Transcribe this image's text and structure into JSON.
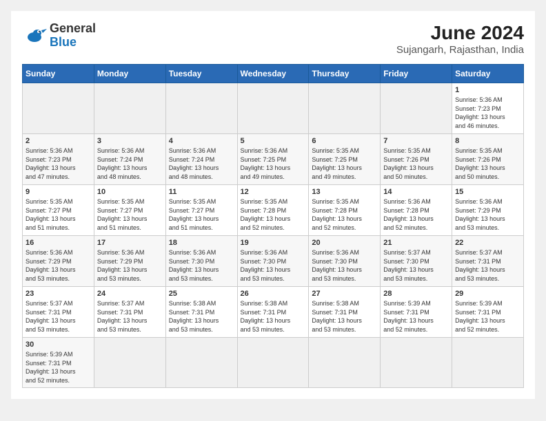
{
  "header": {
    "logo_general": "General",
    "logo_blue": "Blue",
    "title": "June 2024",
    "subtitle": "Sujangarh, Rajasthan, India"
  },
  "days_of_week": [
    "Sunday",
    "Monday",
    "Tuesday",
    "Wednesday",
    "Thursday",
    "Friday",
    "Saturday"
  ],
  "weeks": [
    [
      {
        "day": "",
        "info": ""
      },
      {
        "day": "",
        "info": ""
      },
      {
        "day": "",
        "info": ""
      },
      {
        "day": "",
        "info": ""
      },
      {
        "day": "",
        "info": ""
      },
      {
        "day": "",
        "info": ""
      },
      {
        "day": "1",
        "info": "Sunrise: 5:36 AM\nSunset: 7:23 PM\nDaylight: 13 hours\nand 46 minutes."
      }
    ],
    [
      {
        "day": "2",
        "info": "Sunrise: 5:36 AM\nSunset: 7:23 PM\nDaylight: 13 hours\nand 47 minutes."
      },
      {
        "day": "3",
        "info": "Sunrise: 5:36 AM\nSunset: 7:24 PM\nDaylight: 13 hours\nand 48 minutes."
      },
      {
        "day": "4",
        "info": "Sunrise: 5:36 AM\nSunset: 7:24 PM\nDaylight: 13 hours\nand 48 minutes."
      },
      {
        "day": "5",
        "info": "Sunrise: 5:36 AM\nSunset: 7:25 PM\nDaylight: 13 hours\nand 49 minutes."
      },
      {
        "day": "6",
        "info": "Sunrise: 5:35 AM\nSunset: 7:25 PM\nDaylight: 13 hours\nand 49 minutes."
      },
      {
        "day": "7",
        "info": "Sunrise: 5:35 AM\nSunset: 7:26 PM\nDaylight: 13 hours\nand 50 minutes."
      },
      {
        "day": "8",
        "info": "Sunrise: 5:35 AM\nSunset: 7:26 PM\nDaylight: 13 hours\nand 50 minutes."
      }
    ],
    [
      {
        "day": "9",
        "info": "Sunrise: 5:35 AM\nSunset: 7:27 PM\nDaylight: 13 hours\nand 51 minutes."
      },
      {
        "day": "10",
        "info": "Sunrise: 5:35 AM\nSunset: 7:27 PM\nDaylight: 13 hours\nand 51 minutes."
      },
      {
        "day": "11",
        "info": "Sunrise: 5:35 AM\nSunset: 7:27 PM\nDaylight: 13 hours\nand 51 minutes."
      },
      {
        "day": "12",
        "info": "Sunrise: 5:35 AM\nSunset: 7:28 PM\nDaylight: 13 hours\nand 52 minutes."
      },
      {
        "day": "13",
        "info": "Sunrise: 5:35 AM\nSunset: 7:28 PM\nDaylight: 13 hours\nand 52 minutes."
      },
      {
        "day": "14",
        "info": "Sunrise: 5:36 AM\nSunset: 7:28 PM\nDaylight: 13 hours\nand 52 minutes."
      },
      {
        "day": "15",
        "info": "Sunrise: 5:36 AM\nSunset: 7:29 PM\nDaylight: 13 hours\nand 53 minutes."
      }
    ],
    [
      {
        "day": "16",
        "info": "Sunrise: 5:36 AM\nSunset: 7:29 PM\nDaylight: 13 hours\nand 53 minutes."
      },
      {
        "day": "17",
        "info": "Sunrise: 5:36 AM\nSunset: 7:29 PM\nDaylight: 13 hours\nand 53 minutes."
      },
      {
        "day": "18",
        "info": "Sunrise: 5:36 AM\nSunset: 7:30 PM\nDaylight: 13 hours\nand 53 minutes."
      },
      {
        "day": "19",
        "info": "Sunrise: 5:36 AM\nSunset: 7:30 PM\nDaylight: 13 hours\nand 53 minutes."
      },
      {
        "day": "20",
        "info": "Sunrise: 5:36 AM\nSunset: 7:30 PM\nDaylight: 13 hours\nand 53 minutes."
      },
      {
        "day": "21",
        "info": "Sunrise: 5:37 AM\nSunset: 7:30 PM\nDaylight: 13 hours\nand 53 minutes."
      },
      {
        "day": "22",
        "info": "Sunrise: 5:37 AM\nSunset: 7:31 PM\nDaylight: 13 hours\nand 53 minutes."
      }
    ],
    [
      {
        "day": "23",
        "info": "Sunrise: 5:37 AM\nSunset: 7:31 PM\nDaylight: 13 hours\nand 53 minutes."
      },
      {
        "day": "24",
        "info": "Sunrise: 5:37 AM\nSunset: 7:31 PM\nDaylight: 13 hours\nand 53 minutes."
      },
      {
        "day": "25",
        "info": "Sunrise: 5:38 AM\nSunset: 7:31 PM\nDaylight: 13 hours\nand 53 minutes."
      },
      {
        "day": "26",
        "info": "Sunrise: 5:38 AM\nSunset: 7:31 PM\nDaylight: 13 hours\nand 53 minutes."
      },
      {
        "day": "27",
        "info": "Sunrise: 5:38 AM\nSunset: 7:31 PM\nDaylight: 13 hours\nand 53 minutes."
      },
      {
        "day": "28",
        "info": "Sunrise: 5:39 AM\nSunset: 7:31 PM\nDaylight: 13 hours\nand 52 minutes."
      },
      {
        "day": "29",
        "info": "Sunrise: 5:39 AM\nSunset: 7:31 PM\nDaylight: 13 hours\nand 52 minutes."
      }
    ],
    [
      {
        "day": "30",
        "info": "Sunrise: 5:39 AM\nSunset: 7:31 PM\nDaylight: 13 hours\nand 52 minutes."
      },
      {
        "day": "",
        "info": ""
      },
      {
        "day": "",
        "info": ""
      },
      {
        "day": "",
        "info": ""
      },
      {
        "day": "",
        "info": ""
      },
      {
        "day": "",
        "info": ""
      },
      {
        "day": "",
        "info": ""
      }
    ]
  ]
}
